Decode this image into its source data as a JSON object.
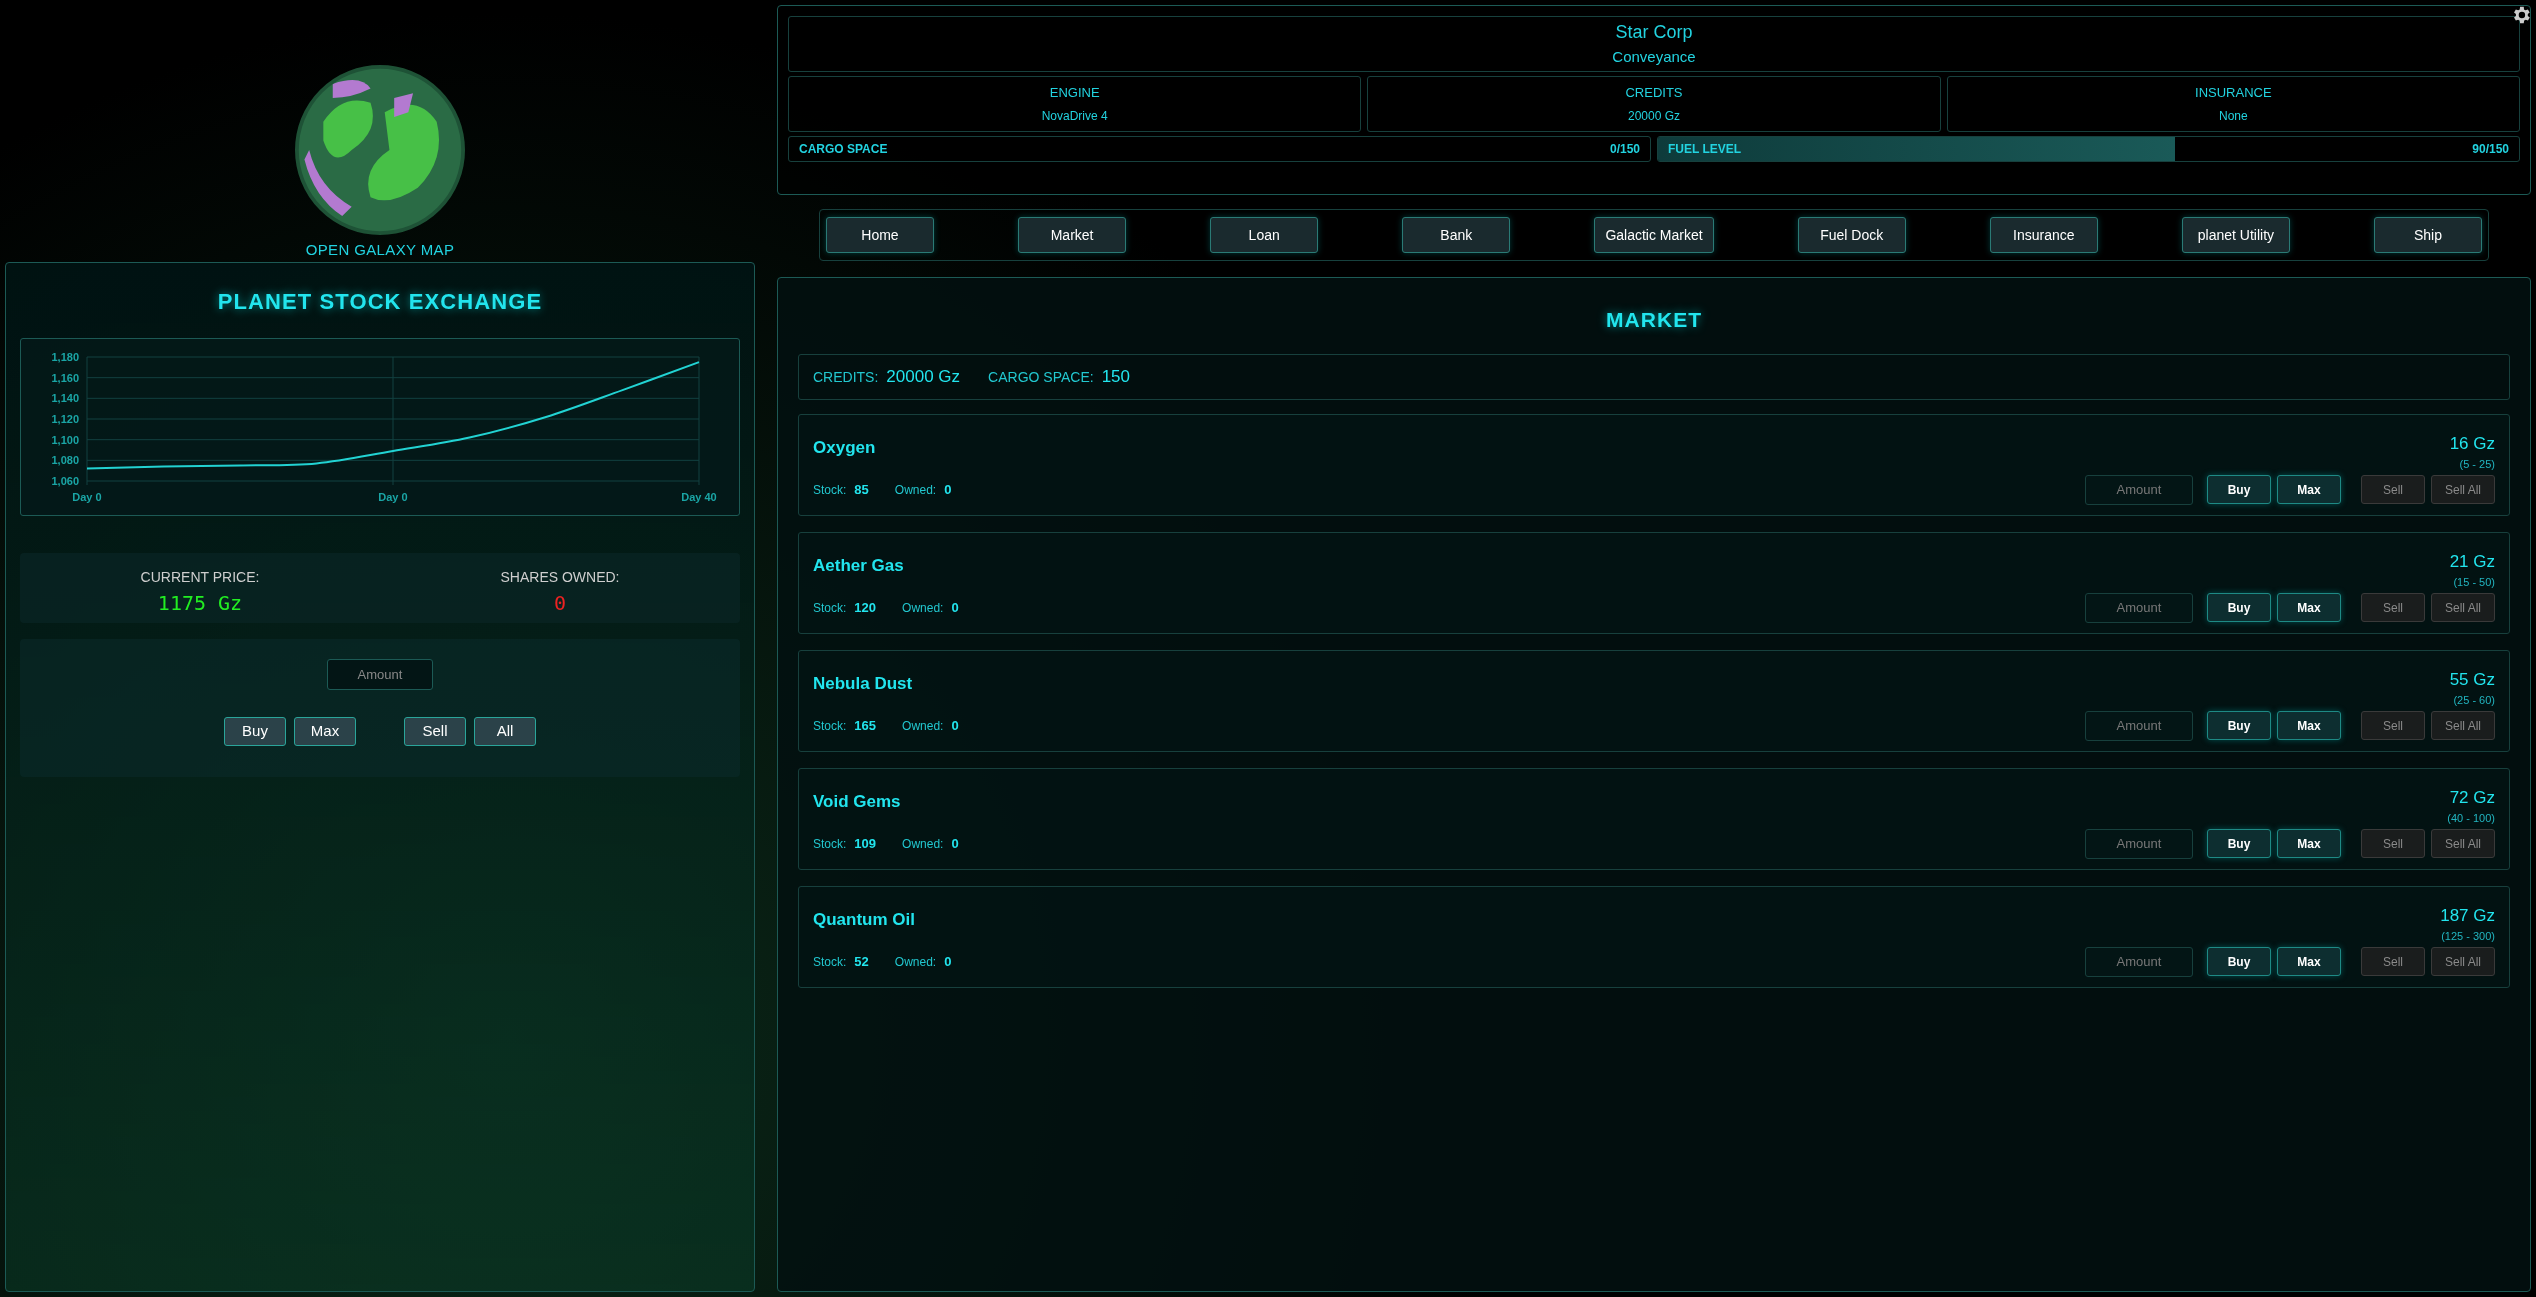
{
  "galaxy_map": {
    "label": "OPEN GALAXY MAP"
  },
  "stock_exchange": {
    "title": "PLANET STOCK EXCHANGE",
    "chart_data": {
      "type": "line",
      "categories": [
        "Day 0",
        null,
        null,
        null,
        "Day 0",
        null,
        null,
        null,
        "Day 40"
      ],
      "series": [
        {
          "color": "#22d3d3",
          "values": [
            1072,
            1074,
            1075,
            1077,
            1089,
            1102,
            1122,
            1148,
            1175
          ]
        }
      ],
      "ylim": [
        1060,
        1180
      ],
      "grid": true,
      "yticks": [
        {
          "value": 1060,
          "label": "1,060"
        },
        {
          "value": 1080,
          "label": "1,080"
        },
        {
          "value": 1100,
          "label": "1,100"
        },
        {
          "value": 1120,
          "label": "1,120"
        },
        {
          "value": 1140,
          "label": "1,140"
        },
        {
          "value": 1160,
          "label": "1,160"
        },
        {
          "value": 1180,
          "label": "1,180"
        }
      ]
    },
    "current_price_label": "CURRENT PRICE:",
    "current_price": "1175 Gz",
    "shares_owned_label": "SHARES OWNED:",
    "shares_owned": "0",
    "amount_placeholder": "Amount",
    "buttons": [
      "Buy",
      "Max",
      "Sell",
      "All"
    ]
  },
  "ship": {
    "name": "Star Corp",
    "type": "Conveyance",
    "stats": [
      {
        "label": "ENGINE",
        "value": "NovaDrive 4"
      },
      {
        "label": "CREDITS",
        "value": "20000 Gz"
      },
      {
        "label": "INSURANCE",
        "value": "None"
      }
    ],
    "cargo": {
      "label": "CARGO SPACE",
      "reading": "0/150"
    },
    "fuel": {
      "label": "FUEL LEVEL",
      "reading": "90/150",
      "level": 0.6
    }
  },
  "nav": [
    {
      "label": "Home",
      "selected": false
    },
    {
      "label": "Market",
      "selected": false
    },
    {
      "label": "Loan",
      "selected": false
    },
    {
      "label": "Bank",
      "selected": false
    },
    {
      "label": "Galactic Market",
      "selected": false
    },
    {
      "label": "Fuel Dock",
      "selected": false
    },
    {
      "label": "Insurance",
      "selected": false
    },
    {
      "label": "planet Utility",
      "selected": false
    },
    {
      "label": "Ship",
      "selected": false
    }
  ],
  "market": {
    "title": "MARKET",
    "credits_label": "CREDITS:",
    "credits": "20000 Gz",
    "cargo_label": "CARGO SPACE:",
    "cargo": "150",
    "items": [
      {
        "name": "Oxygen",
        "price": "16 Gz",
        "range": "(5 - 25)",
        "stock_label": "Stock:",
        "stock": "85",
        "owned_label": "Owned:",
        "owned": "0",
        "placeholder": "Amount",
        "buy": "Buy",
        "max": "Max",
        "sell": "Sell",
        "sell_all": "Sell All",
        "sell_disabled": true
      },
      {
        "name": "Aether Gas",
        "price": "21 Gz",
        "range": "(15 - 50)",
        "stock_label": "Stock:",
        "stock": "120",
        "owned_label": "Owned:",
        "owned": "0",
        "placeholder": "Amount",
        "buy": "Buy",
        "max": "Max",
        "sell": "Sell",
        "sell_all": "Sell All",
        "sell_disabled": true
      },
      {
        "name": "Nebula Dust",
        "price": "55 Gz",
        "range": "(25 - 60)",
        "stock_label": "Stock:",
        "stock": "165",
        "owned_label": "Owned:",
        "owned": "0",
        "placeholder": "Amount",
        "buy": "Buy",
        "max": "Max",
        "sell": "Sell",
        "sell_all": "Sell All",
        "sell_disabled": true
      },
      {
        "name": "Void Gems",
        "price": "72 Gz",
        "range": "(40 - 100)",
        "stock_label": "Stock:",
        "stock": "109",
        "owned_label": "Owned:",
        "owned": "0",
        "placeholder": "Amount",
        "buy": "Buy",
        "max": "Max",
        "sell": "Sell",
        "sell_all": "Sell All",
        "sell_disabled": true
      },
      {
        "name": "Quantum Oil",
        "price": "187 Gz",
        "range": "(125 - 300)",
        "stock_label": "Stock:",
        "stock": "52",
        "owned_label": "Owned:",
        "owned": "0",
        "placeholder": "Amount",
        "buy": "Buy",
        "max": "Max",
        "sell": "Sell",
        "sell_all": "Sell All",
        "sell_disabled": true
      }
    ]
  }
}
